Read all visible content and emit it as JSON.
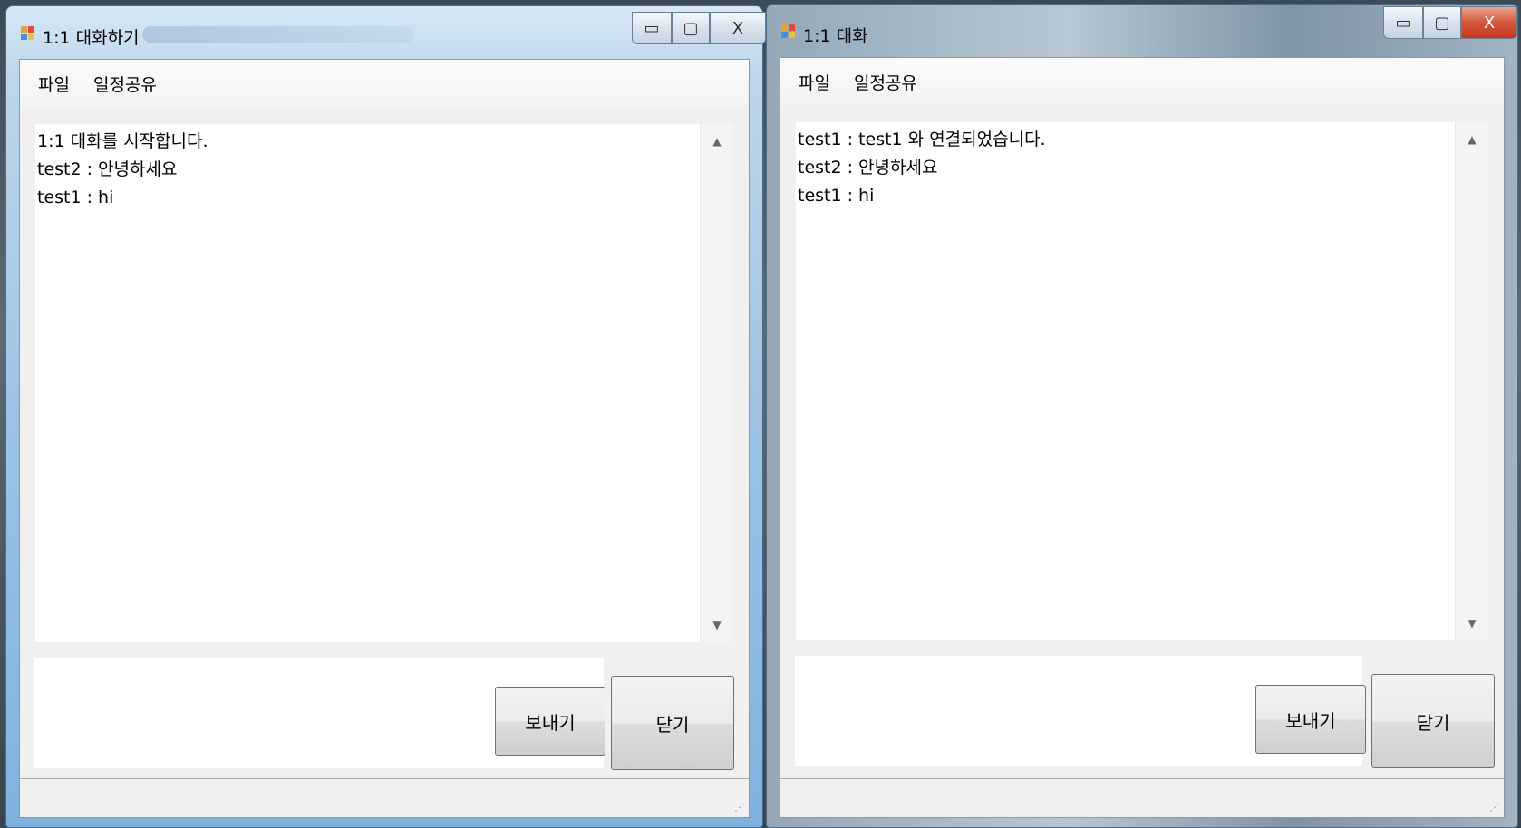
{
  "windows": [
    {
      "title": "1:1 대화하기",
      "menu": [
        "파일",
        "일정공유"
      ],
      "chat_lines": [
        "1:1 대화를 시작합니다.",
        "test2 : 안녕하세요",
        "test1 : hi"
      ],
      "input_value": "",
      "buttons": {
        "send": "보내기",
        "close": "닫기"
      },
      "window_controls": {
        "minimize": "▭",
        "maximize": "▢",
        "close": "X"
      }
    },
    {
      "title": "1:1 대화",
      "menu": [
        "파일",
        "일정공유"
      ],
      "chat_lines": [
        "test1 : test1 와 연결되었습니다.",
        "test2 : 안녕하세요",
        "test1 : hi"
      ],
      "input_value": "",
      "buttons": {
        "send": "보내기",
        "close": "닫기"
      },
      "window_controls": {
        "minimize": "▭",
        "maximize": "▢",
        "close": "X"
      }
    }
  ],
  "icons": {
    "scroll_up": "▲",
    "scroll_down": "▼",
    "resize_grip": "⋰"
  }
}
